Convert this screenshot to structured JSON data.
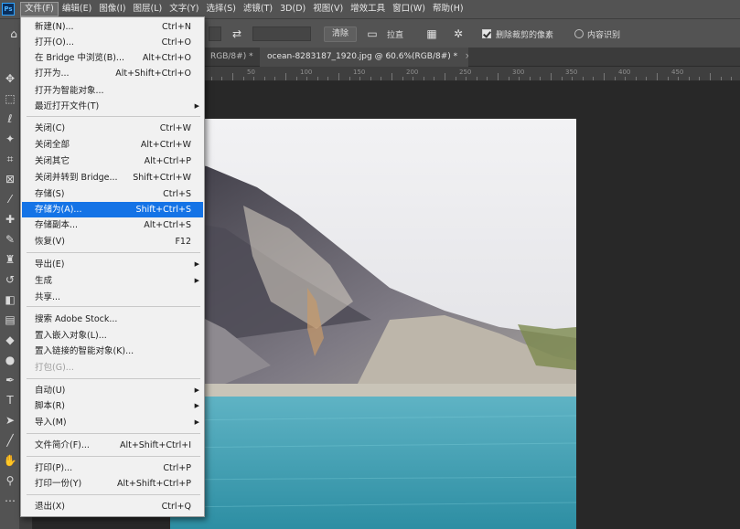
{
  "app": {
    "logo_text": "Ps"
  },
  "menubar": {
    "items": [
      "文件(F)",
      "编辑(E)",
      "图像(I)",
      "图层(L)",
      "文字(Y)",
      "选择(S)",
      "滤镜(T)",
      "3D(D)",
      "视图(V)",
      "增效工具",
      "窗口(W)",
      "帮助(H)"
    ]
  },
  "optionsbar": {
    "clear_label": "清除",
    "straighten_label": "拉直",
    "delete_cropped_label": "删除裁剪的像素",
    "content_aware_label": "内容识别"
  },
  "tabs": {
    "back_tab": "RGB/8#) *",
    "current_tab": "ocean-8283187_1920.jpg @ 60.6%(RGB/8#) *",
    "close_glyph": "×"
  },
  "ruler": {
    "labels": [
      "50",
      "100",
      "150",
      "200",
      "250",
      "300",
      "350",
      "400",
      "450"
    ]
  },
  "file_menu": {
    "items": [
      {
        "label": "新建(N)...",
        "shortcut": "Ctrl+N"
      },
      {
        "label": "打开(O)...",
        "shortcut": "Ctrl+O"
      },
      {
        "label": "在 Bridge 中浏览(B)...",
        "shortcut": "Alt+Ctrl+O"
      },
      {
        "label": "打开为...",
        "shortcut": "Alt+Shift+Ctrl+O"
      },
      {
        "label": "打开为智能对象...",
        "shortcut": ""
      },
      {
        "label": "最近打开文件(T)",
        "shortcut": "",
        "submenu": true
      },
      {
        "label": "关闭(C)",
        "shortcut": "Ctrl+W"
      },
      {
        "label": "关闭全部",
        "shortcut": "Alt+Ctrl+W"
      },
      {
        "label": "关闭其它",
        "shortcut": "Alt+Ctrl+P"
      },
      {
        "label": "关闭并转到 Bridge...",
        "shortcut": "Shift+Ctrl+W"
      },
      {
        "label": "存储(S)",
        "shortcut": "Ctrl+S"
      },
      {
        "label": "存储为(A)...",
        "shortcut": "Shift+Ctrl+S",
        "highlighted": true
      },
      {
        "label": "存储副本...",
        "shortcut": "Alt+Ctrl+S"
      },
      {
        "label": "恢复(V)",
        "shortcut": "F12"
      },
      {
        "label": "导出(E)",
        "shortcut": "",
        "submenu": true
      },
      {
        "label": "生成",
        "shortcut": "",
        "submenu": true
      },
      {
        "label": "共享...",
        "shortcut": ""
      },
      {
        "label": "搜索 Adobe Stock...",
        "shortcut": ""
      },
      {
        "label": "置入嵌入对象(L)...",
        "shortcut": ""
      },
      {
        "label": "置入链接的智能对象(K)...",
        "shortcut": ""
      },
      {
        "label": "打包(G)...",
        "shortcut": "",
        "disabled": true
      },
      {
        "label": "自动(U)",
        "shortcut": "",
        "submenu": true
      },
      {
        "label": "脚本(R)",
        "shortcut": "",
        "submenu": true
      },
      {
        "label": "导入(M)",
        "shortcut": "",
        "submenu": true
      },
      {
        "label": "文件简介(F)...",
        "shortcut": "Alt+Shift+Ctrl+I"
      },
      {
        "label": "打印(P)...",
        "shortcut": "Ctrl+P"
      },
      {
        "label": "打印一份(Y)",
        "shortcut": "Alt+Shift+Ctrl+P"
      },
      {
        "label": "退出(X)",
        "shortcut": "Ctrl+Q"
      }
    ],
    "submenu_glyph": "▶"
  },
  "colors": {
    "menu_highlight": "#1473e6",
    "sky": "#e9e9ec",
    "mountain_dark": "#4a4854",
    "mountain_mid": "#7a7680",
    "scree": "#a9a39b",
    "lake_top": "#5fb3c4",
    "lake_bottom": "#2d8ea3"
  }
}
